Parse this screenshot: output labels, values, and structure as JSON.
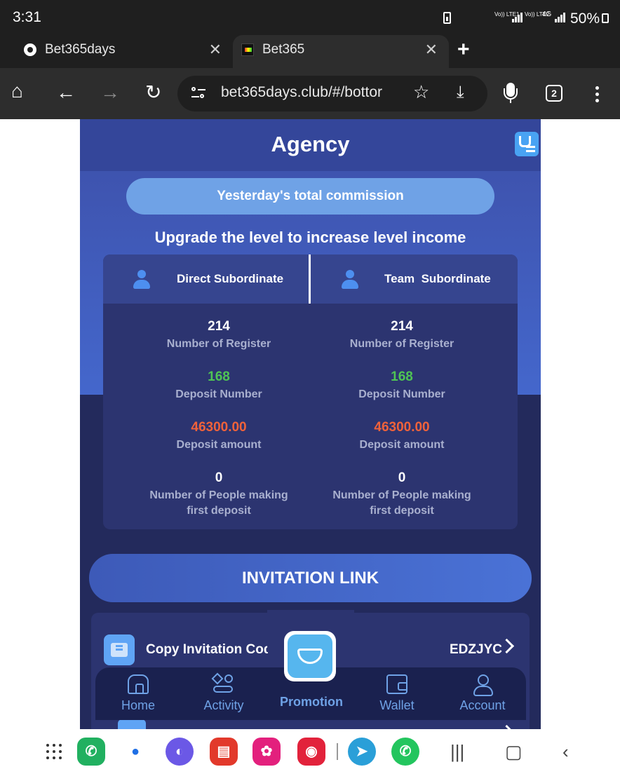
{
  "status_bar": {
    "time": "3:31",
    "sim1_label": "Vo)) LTE1",
    "sim2_label": "Vo)) LTE2",
    "sim2_net": "4G",
    "battery": "50%"
  },
  "browser": {
    "tabs": [
      {
        "title": "Bet365days",
        "active": false
      },
      {
        "title": "Bet365",
        "active": true
      }
    ],
    "url": "bet365days.club/#/bottor",
    "tab_count": "2"
  },
  "page": {
    "header": {
      "title": "Agency"
    },
    "commission_label": "Yesterday's total commission",
    "upgrade_text": "Upgrade the level to increase level income",
    "stats": {
      "direct": {
        "title": "Direct Subordinate",
        "register_count": "214",
        "register_label": "Number of Register",
        "deposit_number": "168",
        "deposit_number_label": "Deposit Number",
        "deposit_amount": "46300.00",
        "deposit_amount_label": "Deposit amount",
        "first_deposit": "0",
        "first_deposit_label": "Number of People making first deposit"
      },
      "team": {
        "title": "Team  Subordinate",
        "register_count": "214",
        "register_label": "Number of Register",
        "deposit_number": "168",
        "deposit_number_label": "Deposit Number",
        "deposit_amount": "46300.00",
        "deposit_amount_label": "Deposit amount",
        "first_deposit": "0",
        "first_deposit_label": "Number of People making first deposit"
      }
    },
    "invitation_button": "INVITATION LINK",
    "invitation_code": {
      "label": "Copy Invitation Code",
      "value": "EDZJYC"
    },
    "bottom_nav": [
      {
        "label": "Home",
        "icon": "home-icon"
      },
      {
        "label": "Activity",
        "icon": "activity-icon"
      },
      {
        "label": "Promotion",
        "icon": "diamond-icon"
      },
      {
        "label": "Wallet",
        "icon": "wallet-icon"
      },
      {
        "label": "Account",
        "icon": "account-icon"
      }
    ]
  },
  "colors": {
    "page_bg": "#232a5c",
    "accent_blue": "#6fa2e6",
    "deposit_number": "#4fc454",
    "deposit_amount": "#f0623a"
  }
}
